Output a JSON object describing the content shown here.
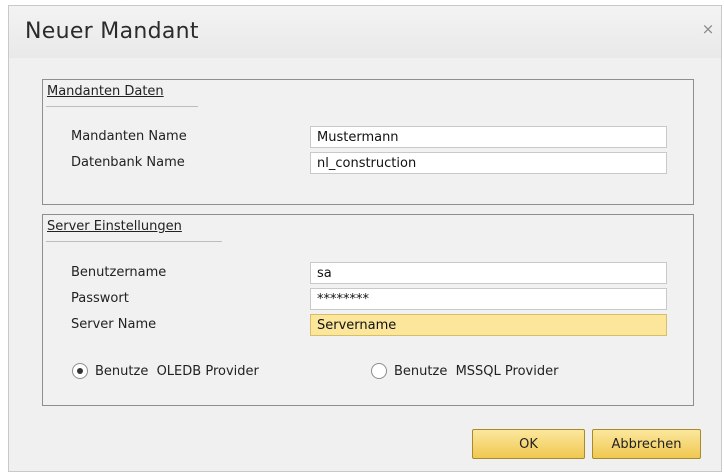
{
  "window": {
    "title": "Neuer Mandant",
    "close_glyph": "×"
  },
  "client_group": {
    "legend": "Mandanten Daten",
    "fields": [
      {
        "label": "Mandanten Name",
        "value": "Mustermann"
      },
      {
        "label": "Datenbank Name",
        "value": "nl_construction"
      }
    ]
  },
  "server_group": {
    "legend": "Server Einstellungen",
    "fields": [
      {
        "label": "Benutzername",
        "value": "sa"
      },
      {
        "label": "Passwort",
        "value": "********"
      },
      {
        "label": "Server Name",
        "value": "Servername"
      }
    ],
    "providers": [
      {
        "label": "Benutze  OLEDB Provider",
        "selected": true
      },
      {
        "label": "Benutze  MSSQL Provider",
        "selected": false
      }
    ]
  },
  "buttons": {
    "ok": "OK",
    "cancel": "Abbrechen"
  },
  "colors": {
    "focus_field": "#fbe69b",
    "button": "#f0c850"
  }
}
